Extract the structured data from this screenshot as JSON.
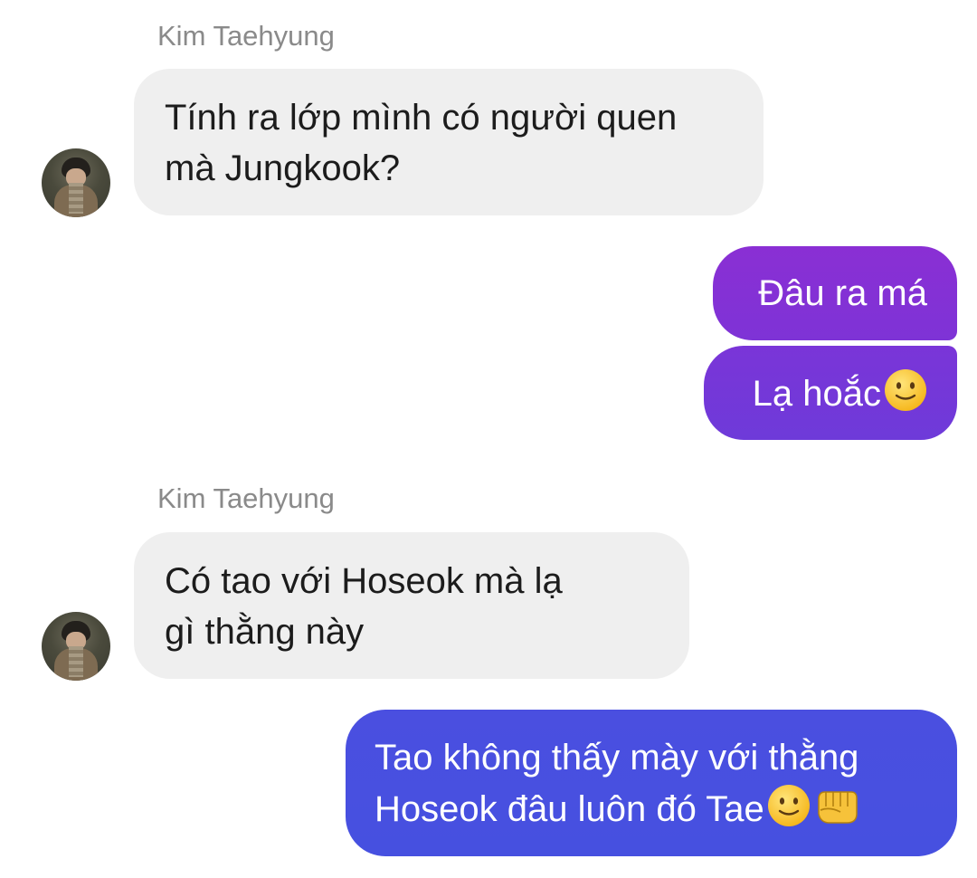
{
  "conversation": {
    "groups": [
      {
        "sender": "Kim Taehyung",
        "message_lines": [
          "Tính ra lớp mình có người quen",
          "mà Jungkook?"
        ]
      },
      {
        "sender": "Kim Taehyung",
        "message_lines": [
          "Có tao với Hoseok mà lạ",
          "gì thằng này"
        ]
      }
    ],
    "outgoing": [
      {
        "text": "Đâu ra má"
      },
      {
        "text": "Lạ hoắc",
        "emoji": [
          "slightly-smiling-face-icon"
        ]
      },
      {
        "lines": [
          "Tao không thấy mày với thằng",
          "Hoseok đâu luôn đó Tae"
        ],
        "emoji": [
          "slightly-smiling-face-icon",
          "oncoming-fist-icon"
        ]
      }
    ]
  },
  "colors": {
    "incoming_bubble": "#efefef",
    "outgoing_gradient_top": "#8a2fd4",
    "outgoing_gradient_bottom": "#4a4fe0",
    "sender_name": "#8a8a8a"
  }
}
